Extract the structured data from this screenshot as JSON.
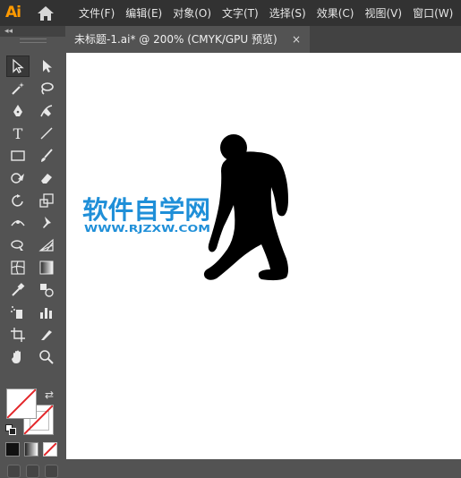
{
  "app": {
    "logo_text": "Ai",
    "icons": {
      "home": "home-icon",
      "tab_close": "close-icon"
    }
  },
  "menu": {
    "items": [
      "文件(F)",
      "编辑(E)",
      "对象(O)",
      "文字(T)",
      "选择(S)",
      "效果(C)",
      "视图(V)",
      "窗口(W)"
    ]
  },
  "toolbar": {
    "collapse_glyph": "◂◂",
    "tools": [
      "selection-tool",
      "direct-selection-tool",
      "magic-wand-tool",
      "lasso-tool",
      "pen-tool",
      "curvature-tool",
      "type-tool",
      "line-segment-tool",
      "rectangle-tool",
      "paintbrush-tool",
      "shaper-tool",
      "eraser-tool",
      "rotate-tool",
      "scale-tool",
      "width-tool",
      "puppet-warp-tool",
      "shape-builder-tool",
      "perspective-grid-tool",
      "mesh-tool",
      "gradient-tool",
      "eyedropper-tool",
      "blend-tool",
      "symbol-sprayer-tool",
      "column-graph-tool",
      "artboard-tool",
      "slice-tool",
      "hand-tool",
      "zoom-tool"
    ],
    "type_glyph": "T",
    "swap_glyph": "⇄",
    "colors": {
      "fill": "#ffffff",
      "stroke_none": "#e3262a"
    }
  },
  "document": {
    "tab_label": "未标题-1.ai* @ 200% (CMYK/GPU 预览)",
    "tab_close_glyph": "×"
  },
  "canvas": {
    "watermark_title": "软件自学网",
    "watermark_url": "WWW.RJZXW.COM",
    "watermark_color": "#1f8fd8",
    "figure_color": "#000000"
  }
}
